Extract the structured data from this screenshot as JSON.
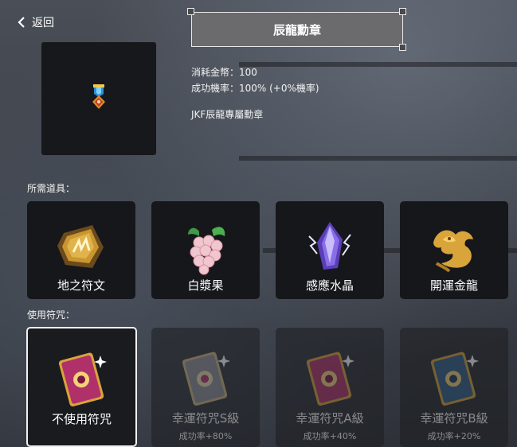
{
  "header": {
    "back_label": "返回",
    "title": "辰龍勳章"
  },
  "item": {
    "cost_text": "消耗金幣：100",
    "rate_text": "成功機率：100% (+0%機率)",
    "description": "JKF辰龍專屬勳章",
    "icon": "medal-icon"
  },
  "materials": {
    "label": "所需道具：",
    "items": [
      {
        "name": "地之符文",
        "icon": "earth-rune-icon"
      },
      {
        "name": "白漿果",
        "icon": "white-berry-icon"
      },
      {
        "name": "感應水晶",
        "icon": "crystal-icon"
      },
      {
        "name": "開運金龍",
        "icon": "golden-dragon-icon"
      }
    ]
  },
  "charms": {
    "label": "使用符咒：",
    "items": [
      {
        "name": "不使用符咒",
        "rate": "",
        "selected": true
      },
      {
        "name": "幸運符咒S級",
        "rate": "成功率+80%"
      },
      {
        "name": "幸運符咒A級",
        "rate": "成功率+40%"
      },
      {
        "name": "幸運符咒B級",
        "rate": "成功率+20%"
      }
    ]
  },
  "colors": {
    "card_bg": "#16171b",
    "title_bg": "#6b6b6d",
    "gold": "#d9a43a",
    "charm_pink": "#b0306a",
    "charm_blue": "#2f5f8a"
  }
}
